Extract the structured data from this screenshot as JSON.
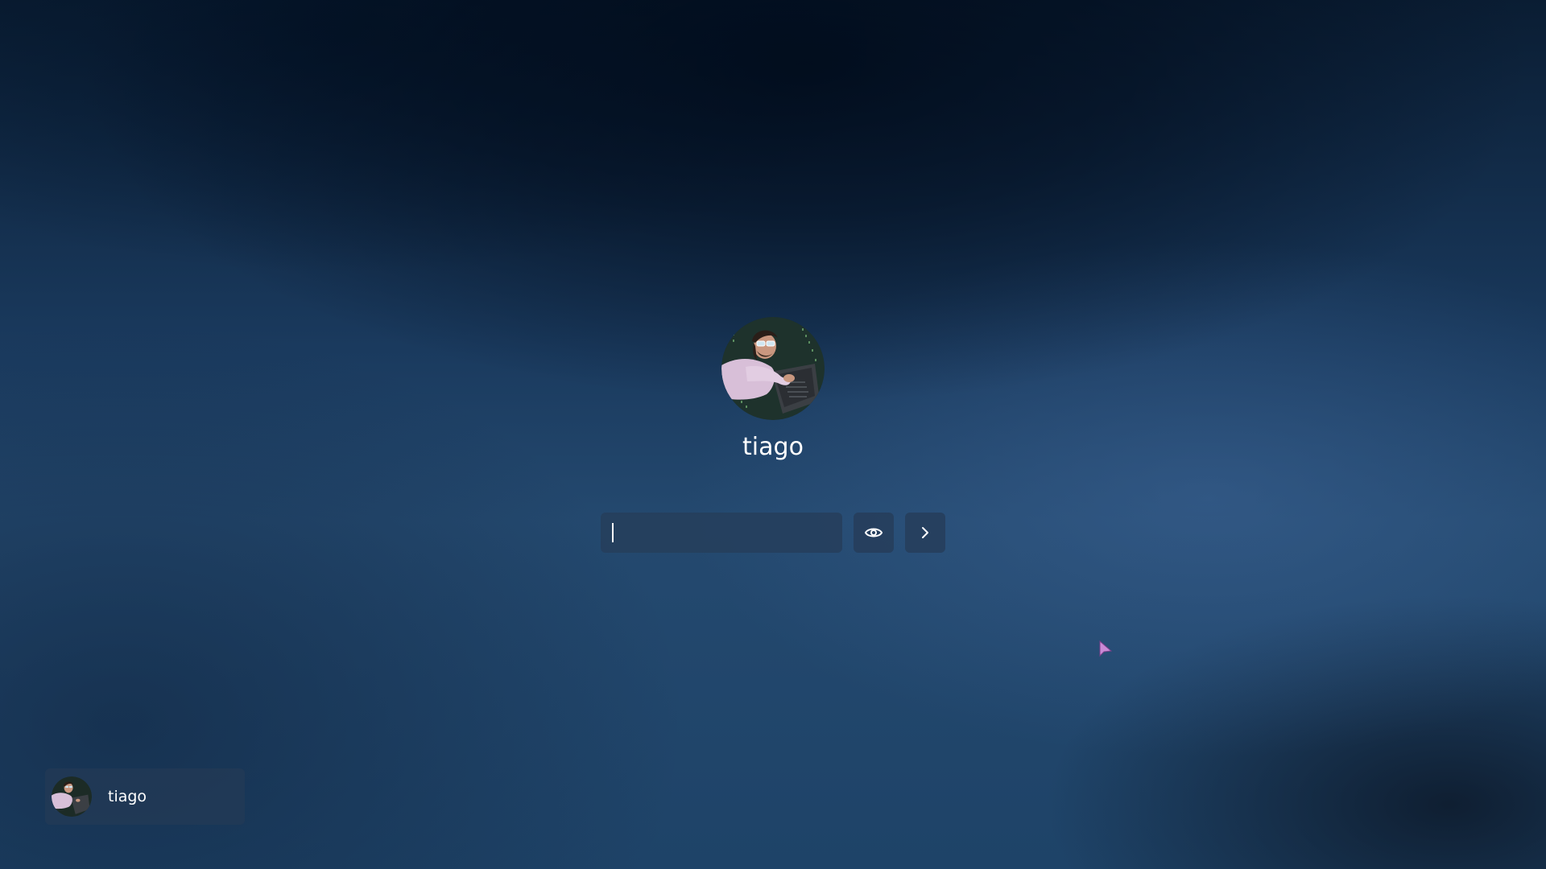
{
  "login": {
    "username": "tiago",
    "avatar_icon": "user-avatar-photo",
    "password_value": "",
    "reveal_icon": "eye-icon",
    "submit_icon": "chevron-right-icon"
  },
  "user_list": [
    {
      "name": "tiago",
      "avatar_icon": "user-avatar-photo"
    }
  ],
  "colors": {
    "background": "#1d3f63",
    "field_bg": "#263e5c",
    "text": "#ffffff",
    "pointer": "#c98ad6"
  }
}
